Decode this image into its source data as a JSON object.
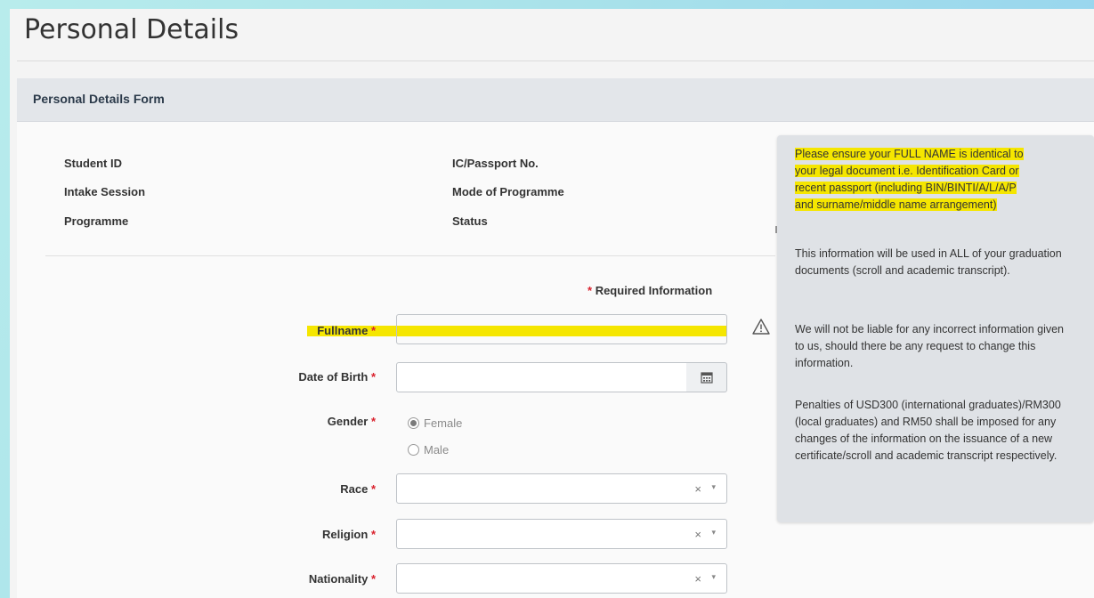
{
  "page_title": "Personal Details",
  "form_title": "Personal Details Form",
  "info_labels": {
    "student_id": "Student ID",
    "intake_session": "Intake Session",
    "programme": "Programme",
    "ic_passport": "IC/Passport No.",
    "mode_of_programme": "Mode of Programme",
    "status": "Status"
  },
  "required_note": {
    "star": "*",
    "text": "Required Information"
  },
  "fields": {
    "fullname": {
      "label": "Fullname",
      "star": "*",
      "value": ""
    },
    "dob": {
      "label": "Date of Birth",
      "star": "*",
      "value": ""
    },
    "gender": {
      "label": "Gender",
      "star": "*",
      "options": [
        "Female",
        "Male"
      ],
      "selected": "Female"
    },
    "race": {
      "label": "Race",
      "star": "*",
      "value": "",
      "clear": "×",
      "caret": "▾"
    },
    "religion": {
      "label": "Religion",
      "star": "*",
      "value": "",
      "clear": "×",
      "caret": "▾"
    },
    "nationality": {
      "label": "Nationality",
      "star": "*",
      "value": "",
      "clear": "×",
      "caret": "▾"
    }
  },
  "tooltip": {
    "highlight_lines": [
      "Please ensure your FULL NAME is identical to",
      "your legal document i.e. Identification Card or",
      "recent passport (including BIN/BINTI/A/L/A/P",
      "and surname/middle name arrangement)"
    ],
    "para1": "This information will be used in ALL of your graduation documents (scroll and academic transcript).",
    "para2": "We will not be liable for any incorrect information given to us, should there be any request to change this information.",
    "para3": "Penalties of USD300 (international graduates)/RM300 (local graduates) and RM50 shall be imposed for any changes of the information on the issuance of a new certificate/scroll and academic transcript respectively."
  },
  "colors": {
    "highlight": "#f5e600",
    "required_star": "#d9202c",
    "panel_header": "#e3e6ea",
    "tooltip_bg": "#dfe2e6"
  },
  "icons": [
    "warning-icon",
    "calendar-icon",
    "clear-icon",
    "chevron-down-icon"
  ]
}
